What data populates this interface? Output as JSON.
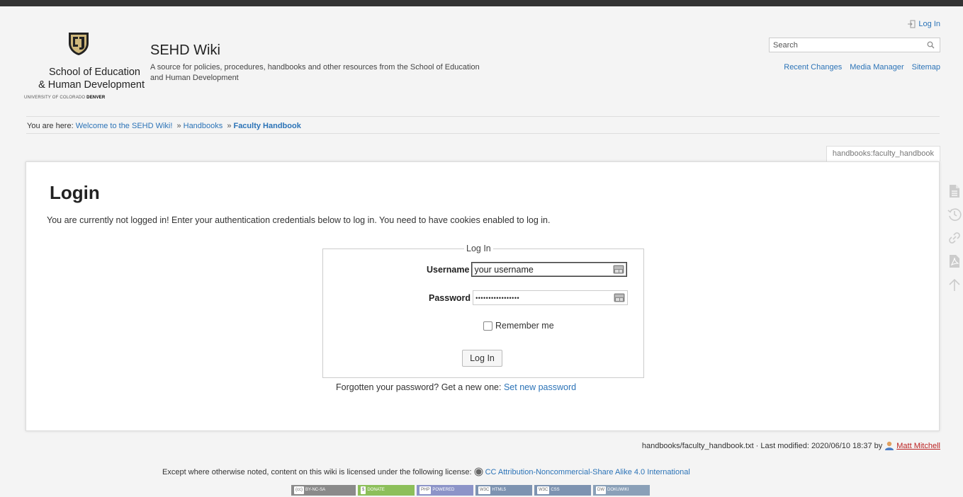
{
  "header": {
    "logo_line1": "School of Education",
    "logo_line2": "& Human Development",
    "logo_small_a": "UNIVERSITY OF COLORADO ",
    "logo_small_b": "DENVER",
    "site_title": "SEHD Wiki",
    "tagline": "A source for policies, procedures, handbooks and other resources from the School of Education and Human Development",
    "login_link": "Log In",
    "search_placeholder": "Search",
    "tools": [
      "Recent Changes",
      "Media Manager",
      "Sitemap"
    ]
  },
  "breadcrumb": {
    "prefix": "You are here: ",
    "items": [
      "Welcome to the SEHD Wiki!",
      "Handbooks"
    ],
    "separator": "»",
    "current": "Faculty Handbook"
  },
  "page_id": "handbooks:faculty_handbook",
  "login": {
    "title": "Login",
    "intro": "You are currently not logged in! Enter your authentication credentials below to log in. You need to have cookies enabled to log in.",
    "legend": "Log In",
    "username_label": "Username",
    "username_value": "your username",
    "password_label": "Password",
    "password_value": "•••••••••••••••••",
    "remember_label": "Remember me",
    "remember_checked": false,
    "submit_label": "Log In",
    "forgot_text": "Forgotten your password? Get a new one: ",
    "forgot_link": "Set new password"
  },
  "page_tools": [
    "page-icon",
    "history-icon",
    "link-icon",
    "pdf-icon",
    "arrow-up-icon"
  ],
  "doc_info": {
    "text": "handbooks/faculty_handbook.txt · Last modified: 2020/06/10 18:37 by",
    "user": "Matt Mitchell"
  },
  "license": {
    "text": "Except where otherwise noted, content on this wiki is licensed under the following license:",
    "link": "CC Attribution-Noncommercial-Share Alike 4.0 International"
  },
  "footer_buttons": [
    {
      "label": "(cc)",
      "text": "BY-NC-SA",
      "color": "#8a8a8a"
    },
    {
      "label": "$",
      "text": "DONATE",
      "color": "#8cbf5a"
    },
    {
      "label": "PHP",
      "text": "POWERED",
      "color": "#8c94c8"
    },
    {
      "label": "W3C",
      "text": "HTML5",
      "color": "#7d93b1"
    },
    {
      "label": "W3C",
      "text": "CSS",
      "color": "#7d93b1"
    },
    {
      "label": "DW",
      "text": "DOKUWIKI",
      "color": "#8aa0b8"
    }
  ],
  "colors": {
    "link": "#2b73b7",
    "logo_gold": "#cfb87c",
    "top_bar": "#333333",
    "user_link": "#bb2222"
  }
}
